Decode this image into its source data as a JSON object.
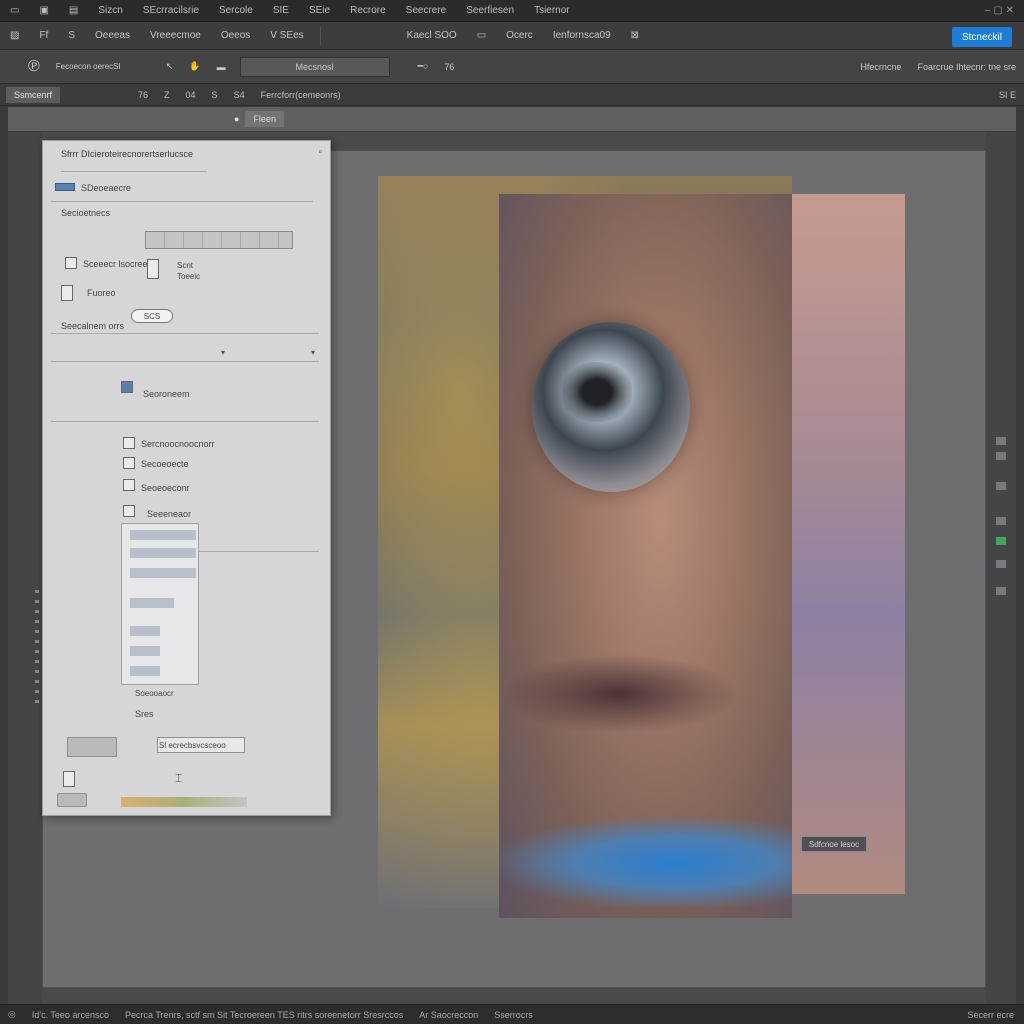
{
  "menubar": {
    "items": [
      "Sizcn",
      "SEcrracilsrie",
      "Sercole",
      "SIE",
      "SEie",
      "Recrore",
      "Seecrere",
      "Seerfiesen",
      "Tsiernor"
    ]
  },
  "toolbar": {
    "items": [
      "Ff",
      "S",
      "Oeeeas",
      "Vreeecmoe",
      "Oeeos",
      "V SEes"
    ],
    "center_items": [
      "Kaecl SOO",
      "Ocerc",
      "Ienfornsca09"
    ],
    "share_label": "Stcneckil"
  },
  "options_bar": {
    "label": "Fecoecon oerecSI",
    "field_value": "Mecsnosl",
    "value_label": "76",
    "right_items": [
      "Hfecrncne",
      "Foarcrue Ihtecnr: tne sre"
    ]
  },
  "tabbar": {
    "doc_tab": "Ssmcenrf",
    "items": [
      "76",
      "Z",
      "04",
      "S",
      "S4",
      "Ferrcforr(cemeonrs)"
    ],
    "right": "SI E"
  },
  "subbar": {
    "chip": "Fleen"
  },
  "panel": {
    "title": "Sfrrr DIcieroteirecnorertserlucsce",
    "row1": "SDeoeaecre",
    "section1": "Secioetnecs",
    "line1": "Sceeecr lsocreen",
    "line1b": "Scnt",
    "line1c": "Toeeic",
    "line2": "Fuoreo",
    "pill": "SCS",
    "section2": "Seecalnem orrs",
    "row2": "Seoroneem",
    "list": [
      "Sercnoocnoocnorr",
      "Secoeoecte",
      "Seoeoeconr",
      "Seeeneaor"
    ],
    "caption": "Soeooaocr",
    "label_s": "Sres",
    "field2": "Sl ecrecbsvcsceoo"
  },
  "canvas": {
    "tag": "Sdfcnoe lesoc"
  },
  "statusbar": {
    "left": "Id'c. Teeo arcensco",
    "center": "Pecrca Trenrs, sctf sm Sit Tecroereen TES ritrs soreenetorr Sresrccos",
    "mid": "Ar Saocreccon",
    "mid2": "Sserrocrs",
    "right": "Secerr ecre"
  },
  "colors": {
    "accent": "#1e7ed6",
    "panel_bg": "#d6d6d8",
    "workspace": "#4a4a4d"
  }
}
